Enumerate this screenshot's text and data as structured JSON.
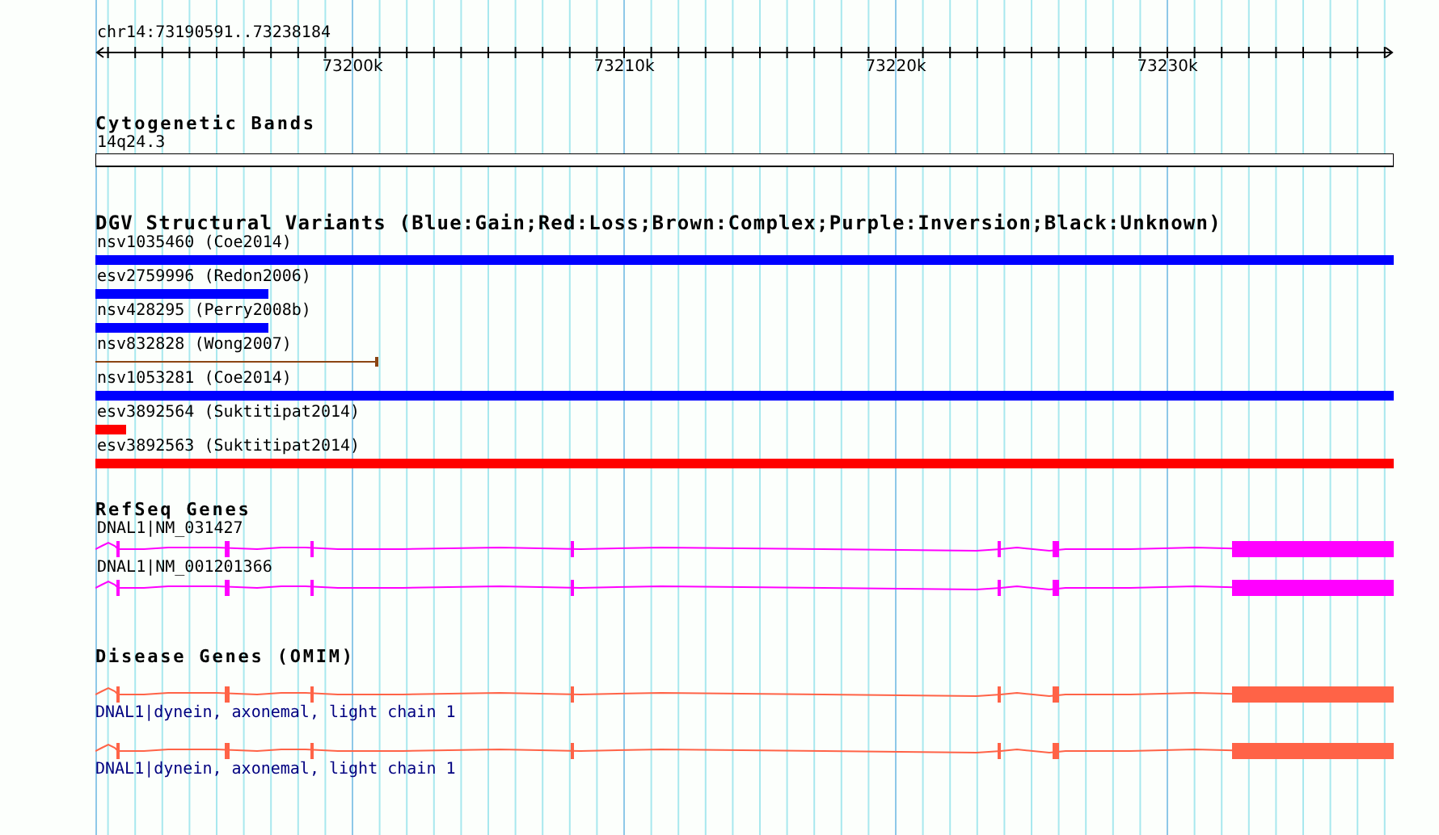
{
  "ruler": {
    "range": "chr14:73190591..73238184",
    "ticks": [
      "73200k",
      "73210k",
      "73220k",
      "73230k"
    ]
  },
  "tracks": [
    {
      "kind": "bands",
      "title": "Cytogenetic Bands",
      "features": [
        {
          "label": "14q24.3"
        }
      ]
    },
    {
      "kind": "variants",
      "title": "DGV Structural Variants (Blue:Gain;Red:Loss;Brown:Complex;Purple:Inversion;Black:Unknown)",
      "features": [
        {
          "label": "nsv1035460 (Coe2014)",
          "color": "#0000ff",
          "kind": "bar"
        },
        {
          "label": "esv2759996 (Redon2006)",
          "color": "#0000ff",
          "kind": "bar"
        },
        {
          "label": "nsv428295 (Perry2008b)",
          "color": "#0000ff",
          "kind": "bar"
        },
        {
          "label": "nsv832828 (Wong2007)",
          "color": "#8b4513",
          "kind": "line"
        },
        {
          "label": "nsv1053281 (Coe2014)",
          "color": "#0000ff",
          "kind": "bar"
        },
        {
          "label": "esv3892564 (Suktitipat2014)",
          "color": "#ff0000",
          "kind": "bar"
        },
        {
          "label": "esv3892563 (Suktitipat2014)",
          "color": "#ff0000",
          "kind": "bar"
        }
      ]
    },
    {
      "kind": "refseq",
      "title": "RefSeq Genes",
      "features": [
        {
          "label": "DNAL1|NM_031427"
        },
        {
          "label": "DNAL1|NM_001201366"
        }
      ]
    },
    {
      "kind": "omim",
      "title": "Disease Genes (OMIM)",
      "features": [
        {
          "label": "DNAL1|dynein, axonemal, light chain 1"
        },
        {
          "label": "DNAL1|dynein, axonemal, light chain 1"
        }
      ]
    }
  ]
}
